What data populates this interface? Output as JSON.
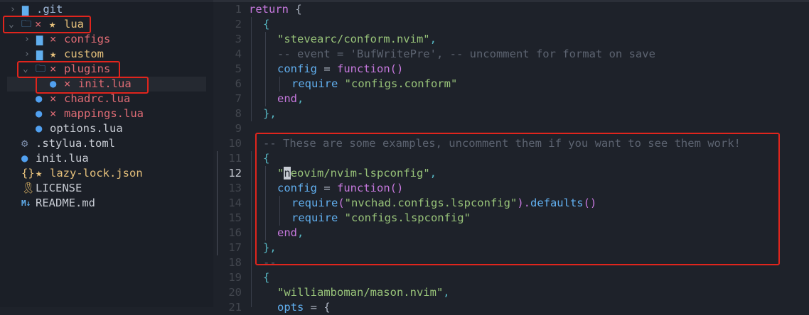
{
  "explorer": {
    "rows": [
      {
        "chevron": "›",
        "icon": "▆",
        "x_mark": "",
        "star": "",
        "name": ".git"
      },
      {
        "chevron": "⌄",
        "icon": "🗀",
        "x_mark": "×",
        "star": "★",
        "name": "lua"
      },
      {
        "chevron": "›",
        "icon": "▆",
        "x_mark": "×",
        "star": "",
        "name": "configs"
      },
      {
        "chevron": "›",
        "icon": "▆",
        "x_mark": "",
        "star": "★",
        "name": "custom"
      },
      {
        "chevron": "⌄",
        "icon": "🗀",
        "x_mark": "×",
        "star": "",
        "name": "plugins"
      },
      {
        "chevron": "",
        "icon": "●",
        "x_mark": "×",
        "star": "",
        "name": "init.lua"
      },
      {
        "chevron": "",
        "icon": "●",
        "x_mark": "×",
        "star": "",
        "name": "chadrc.lua"
      },
      {
        "chevron": "",
        "icon": "●",
        "x_mark": "×",
        "star": "",
        "name": "mappings.lua"
      },
      {
        "chevron": "",
        "icon": "●",
        "x_mark": "",
        "star": "",
        "name": "options.lua"
      },
      {
        "chevron": "",
        "icon": "⚙",
        "x_mark": "",
        "star": "",
        "name": ".stylua.toml"
      },
      {
        "chevron": "",
        "icon": "●",
        "x_mark": "",
        "star": "",
        "name": "init.lua"
      },
      {
        "chevron": "",
        "icon": "{}",
        "x_mark": "",
        "star": "★",
        "name": "lazy-lock.json"
      },
      {
        "chevron": "",
        "icon": "🎗",
        "x_mark": "",
        "star": "",
        "name": "LICENSE"
      },
      {
        "chevron": "",
        "icon": "M↓",
        "x_mark": "",
        "star": "",
        "name": "README.md"
      }
    ]
  },
  "editor": {
    "current_line": "12",
    "line_numbers": [
      "1",
      "2",
      "3",
      "4",
      "5",
      "6",
      "7",
      "8",
      "9",
      "10",
      "11",
      "12",
      "13",
      "14",
      "15",
      "16",
      "17",
      "18",
      "19",
      "20",
      "21"
    ],
    "lines": {
      "l1_kw": "return",
      "l1_rest": " {",
      "l2": "{",
      "l3_str": "\"stevearc/conform.nvim\"",
      "l3_comma": ",",
      "l4_comment": "-- event = 'BufWritePre', -- uncomment for format on save",
      "l5_var": "config",
      "l5_eq": " = ",
      "l5_fn": "function",
      "l5_paren": "()",
      "l6_fn": "require",
      "l6_str": " \"configs.conform\"",
      "l7_end": "end",
      "l7_comma": ",",
      "l8": "},",
      "l10_comment": "-- These are some examples, uncomment them if you want to see them work!",
      "l11": "{",
      "l12_quote": "\"",
      "l12_cursor": "n",
      "l12_rest": "eovim/nvim-lspconfig\"",
      "l12_comma": ",",
      "l13_var": "config",
      "l13_eq": " = ",
      "l13_fn": "function",
      "l13_paren": "()",
      "l14_fn": "require",
      "l14_open": "(",
      "l14_str": "\"nvchad.configs.lspconfig\"",
      "l14_close": ").",
      "l14_method": "defaults",
      "l14_call": "()",
      "l15_fn": "require",
      "l15_str": " \"configs.lspconfig\"",
      "l16_end": "end",
      "l16_comma": ",",
      "l17": "},",
      "l18_comment": "--",
      "l19": "{",
      "l20_str": "\"williamboman/mason.nvim\"",
      "l20_comma": ",",
      "l21_var": "opts",
      "l21_rest": " = {"
    }
  },
  "colors": {
    "highlight_box": "#e0251d",
    "background": "#1e222a",
    "sidebar_bg": "#1b1f27"
  }
}
